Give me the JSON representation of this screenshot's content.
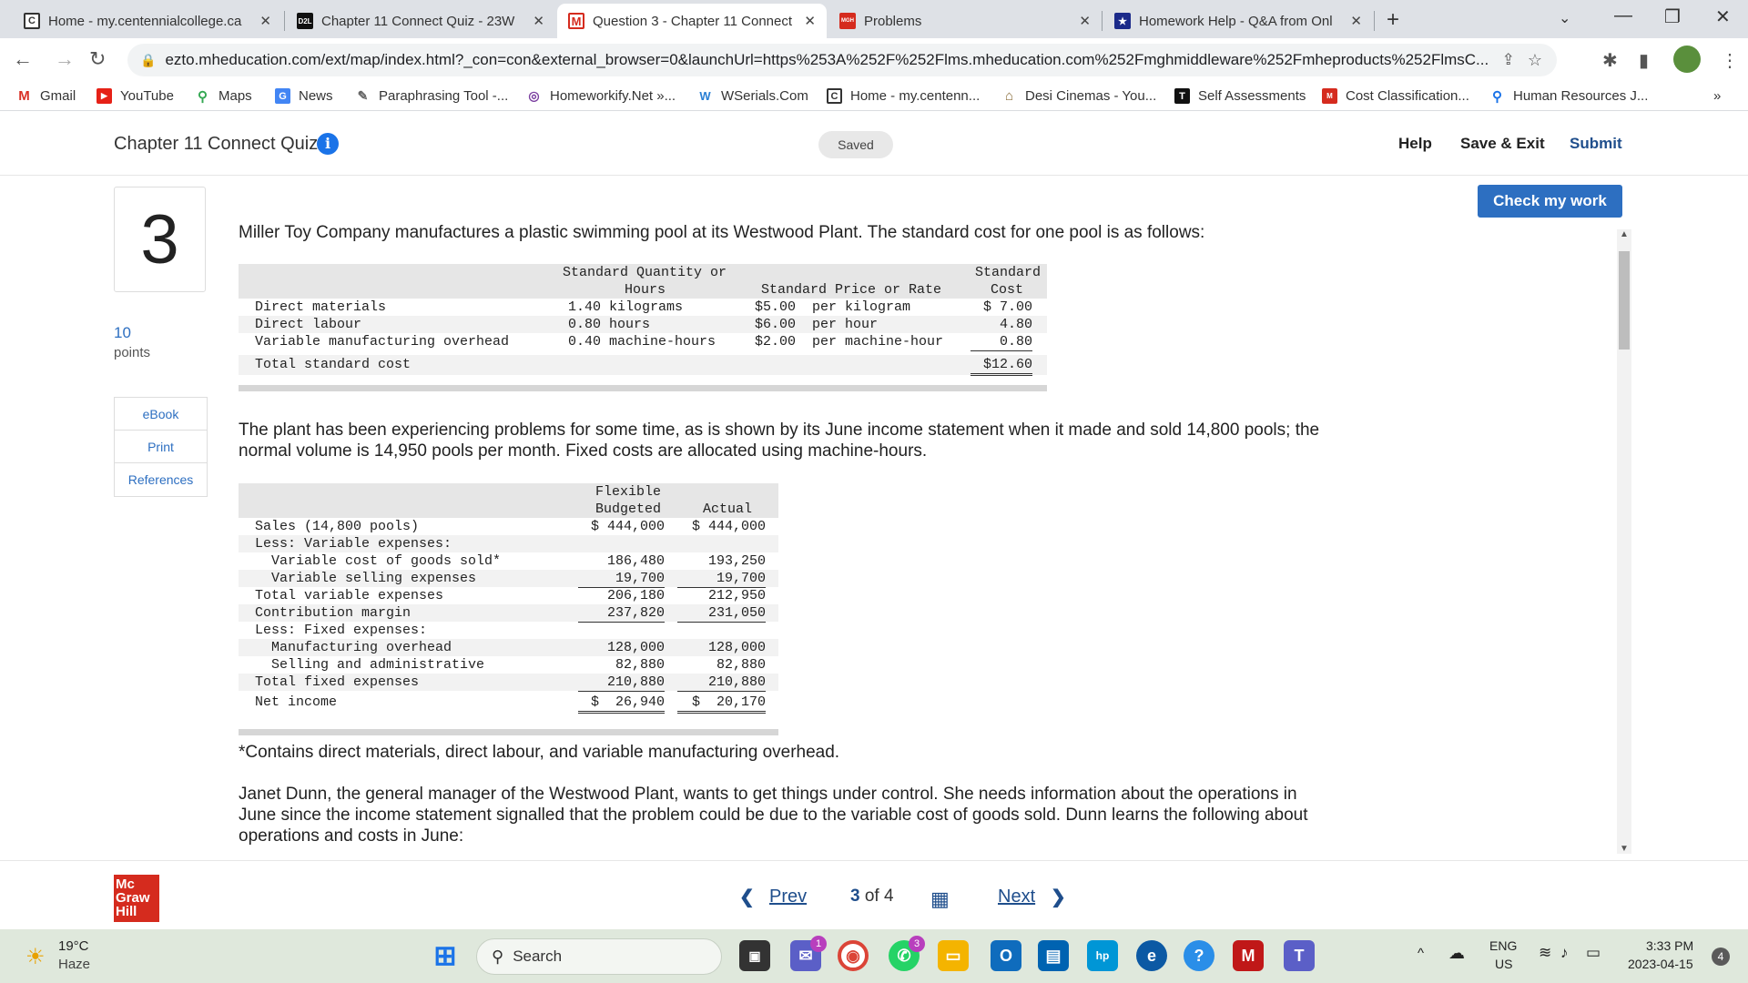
{
  "browser": {
    "tabs": [
      {
        "title": "Home - my.centennialcollege.ca",
        "icon": "C",
        "color": "#333333"
      },
      {
        "title": "Chapter 11 Connect Quiz - 23W",
        "icon": "D2L",
        "color": "#111111"
      },
      {
        "title": "Question 3 - Chapter 11 Connect",
        "icon": "M",
        "color": "#d52b1e"
      },
      {
        "title": "Problems",
        "icon": "MGH",
        "color": "#d52b1e"
      },
      {
        "title": "Homework Help - Q&A from Onl",
        "icon": "★",
        "color": "#1b2a8a"
      }
    ],
    "new_tab": "+",
    "url": "ezto.mheducation.com/ext/map/index.html?_con=con&external_browser=0&launchUrl=https%253A%252F%252Flms.mheducation.com%252Fmghmiddleware%252Fmheproducts%252FlmsC...",
    "bookmarks": [
      {
        "label": "Gmail",
        "icon": "M",
        "color": "#d93025"
      },
      {
        "label": "YouTube",
        "icon": "▶",
        "color": "#e62117"
      },
      {
        "label": "Maps",
        "icon": "⚲",
        "color": "#34a853"
      },
      {
        "label": "News",
        "icon": "G",
        "color": "#4285f4"
      },
      {
        "label": "Paraphrasing Tool -...",
        "icon": "✎",
        "color": "#666666"
      },
      {
        "label": "Homeworkify.Net »...",
        "icon": "◎",
        "color": "#7b3fa0"
      },
      {
        "label": "WSerials.Com",
        "icon": "W",
        "color": "#2a7fd4"
      },
      {
        "label": "Home - my.centenn...",
        "icon": "C",
        "color": "#333333"
      },
      {
        "label": "Desi Cinemas - You...",
        "icon": "⌂",
        "color": "#8a6d3b"
      },
      {
        "label": "Self Assessments",
        "icon": "T",
        "color": "#111111"
      },
      {
        "label": "Cost Classification...",
        "icon": "M",
        "color": "#d52b1e"
      },
      {
        "label": "Human Resources J...",
        "icon": "⚲",
        "color": "#1a73e8"
      }
    ],
    "bookmarks_more": "»"
  },
  "header": {
    "quiz_title": "Chapter 11 Connect Quiz",
    "info_icon": "i",
    "saved": "Saved",
    "help": "Help",
    "save_exit": "Save & Exit",
    "submit": "Submit"
  },
  "question": {
    "number": "3",
    "points_value": "10",
    "points_label": "points",
    "side_links": [
      "eBook",
      "Print",
      "References"
    ],
    "check_my_work": "Check my work",
    "intro": "Miller Toy Company manufactures a plastic swimming pool at its Westwood Plant. The standard cost for one pool is as follows:",
    "std_table": {
      "headers": {
        "qty_line1": "Standard Quantity or",
        "qty_line2": "Hours",
        "price": "Standard Price or Rate",
        "cost_line1": "Standard",
        "cost_line2": "Cost"
      },
      "rows": [
        {
          "label": "Direct materials",
          "qty": "1.40 kilograms",
          "price": "$5.00  per kilogram",
          "cost": "$ 7.00"
        },
        {
          "label": "Direct labour",
          "qty": "0.80 hours",
          "price": "$6.00  per hour",
          "cost": "4.80"
        },
        {
          "label": "Variable manufacturing overhead",
          "qty": "0.40 machine-hours",
          "price": "$2.00  per machine-hour",
          "cost": "0.80"
        }
      ],
      "total_label": "Total standard cost",
      "total_cost": "$12.60"
    },
    "para2": "The plant has been experiencing problems for some time, as is shown by its June income statement when it made and sold 14,800 pools; the normal volume is 14,950 pools per month. Fixed costs are allocated using machine-hours.",
    "income": {
      "headers": {
        "flex_line1": "Flexible",
        "flex_line2": "Budgeted",
        "actual": "Actual"
      },
      "rows": [
        {
          "label": "Sales (14,800 pools)",
          "flex": "$ 444,000",
          "actual": "$ 444,000",
          "indent": 0
        },
        {
          "label": "Less: Variable expenses:",
          "flex": "",
          "actual": "",
          "indent": 0
        },
        {
          "label": "Variable cost of goods sold*",
          "flex": "186,480",
          "actual": "193,250",
          "indent": 1
        },
        {
          "label": "Variable selling expenses",
          "flex": "19,700",
          "actual": "19,700",
          "indent": 1
        },
        {
          "label": "Total variable expenses",
          "flex": "206,180",
          "actual": "212,950",
          "indent": 0
        },
        {
          "label": "Contribution margin",
          "flex": "237,820",
          "actual": "231,050",
          "indent": 0
        },
        {
          "label": "Less: Fixed expenses:",
          "flex": "",
          "actual": "",
          "indent": 0
        },
        {
          "label": "Manufacturing overhead",
          "flex": "128,000",
          "actual": "128,000",
          "indent": 1
        },
        {
          "label": "Selling and administrative",
          "flex": "82,880",
          "actual": "82,880",
          "indent": 1
        },
        {
          "label": "Total fixed expenses",
          "flex": "210,880",
          "actual": "210,880",
          "indent": 0
        },
        {
          "label": "Net income",
          "flex": "$  26,940",
          "actual": "$  20,170",
          "indent": 0
        }
      ]
    },
    "footnote": "*Contains direct materials, direct labour, and variable manufacturing overhead.",
    "para3": "Janet Dunn, the general manager of the Westwood Plant, wants to get things under control. She needs information about the operations in June since the income statement signalled that the problem could be due to the variable cost of goods sold. Dunn learns the following about operations and costs in June:"
  },
  "footer": {
    "logo": "Mc Graw Hill",
    "prev": "Prev",
    "page_current": "3",
    "page_of": "of",
    "page_total": "4",
    "next": "Next"
  },
  "taskbar": {
    "weather_temp": "19°C",
    "weather_desc": "Haze",
    "search": "Search",
    "badges": {
      "messenger": "1",
      "whatsapp": "3"
    },
    "lang1": "ENG",
    "lang2": "US",
    "time": "3:33 PM",
    "date": "2023-04-15",
    "notif": "4"
  }
}
